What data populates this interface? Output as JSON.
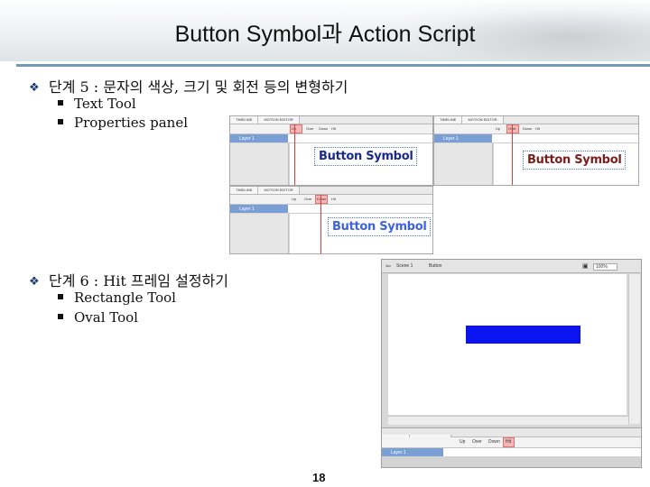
{
  "title": "Button Symbol과 Action Script",
  "step5": {
    "heading": "단계 5 : 문자의 색상, 크기 및 회전 등의 변형하기",
    "items": [
      "Text Tool",
      "Properties panel"
    ]
  },
  "step6": {
    "heading": "단계 6 : Hit 프레임 설정하기",
    "items": [
      "Rectangle Tool",
      "Oval Tool"
    ]
  },
  "panels": {
    "tab_timeline": "TIMELINE",
    "tab_motion": "MOTION EDITOR",
    "frame_up": "Up",
    "frame_over": "Over",
    "frame_down": "Down",
    "frame_hit": "Hit",
    "layer": "Layer 1",
    "button_text": "Button Symbol"
  },
  "flash2": {
    "scene": "Scene 1",
    "symbol": "Button",
    "zoom": "100%",
    "tab_timeline": "TIMELINE",
    "tab_motion": "MOTION EDITOR",
    "layer": "Layer 1",
    "frame_up": "Up",
    "frame_over": "Over",
    "frame_down": "Down",
    "frame_hit": "Hit"
  },
  "page_number": "18",
  "colors": {
    "accent": "#6f9ab8",
    "hit_rect": "#0b14f0",
    "playhead": "#e53935"
  }
}
